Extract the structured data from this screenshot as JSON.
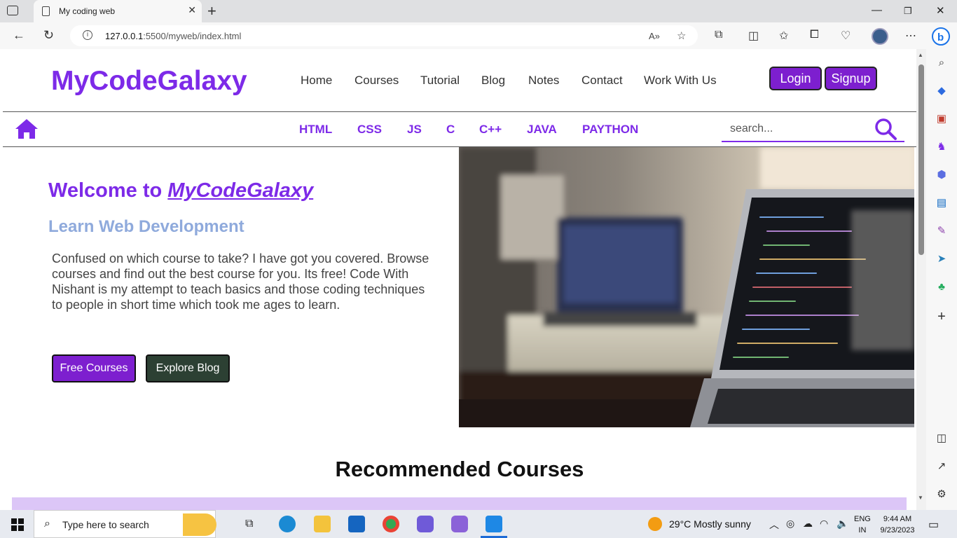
{
  "browser": {
    "tab_title": "My coding web",
    "url_host": "127.0.0.1",
    "url_rest": ":5500/myweb/index.html"
  },
  "site": {
    "logo": "MyCodeGalaxy",
    "nav": [
      "Home",
      "Courses",
      "Tutorial",
      "Blog",
      "Notes",
      "Contact",
      "Work With Us"
    ],
    "login_label": "Login",
    "signup_label": "Signup",
    "languages": [
      "HTML",
      "CSS",
      "JS",
      "C",
      "C++",
      "JAVA",
      "PAYTHON"
    ],
    "search_placeholder": "search..."
  },
  "hero": {
    "welcome": "Welcome to",
    "brand": "MyCodeGalaxy",
    "subtitle": "Learn Web Development",
    "description": "Confused on which course to take? I have got you covered. Browse courses and find out the best course for you. Its free! Code With Nishant is my attempt to teach basics and those coding techniques to people in short time which took me ages to learn.",
    "btn_courses": "Free Courses",
    "btn_blog": "Explore Blog"
  },
  "sections": {
    "recommended": "Recommended Courses"
  },
  "taskbar": {
    "search_placeholder": "Type here to search",
    "weather": "29°C  Mostly sunny",
    "lang_1": "ENG",
    "lang_2": "IN",
    "time": "9:44 AM",
    "date": "9/23/2023"
  },
  "colors": {
    "brand": "#7d2ae8",
    "button_purple": "#7d1fcf",
    "button_dark": "#2c4033",
    "subtitle": "#8faadc",
    "course_strip": "#dcc6f7"
  }
}
